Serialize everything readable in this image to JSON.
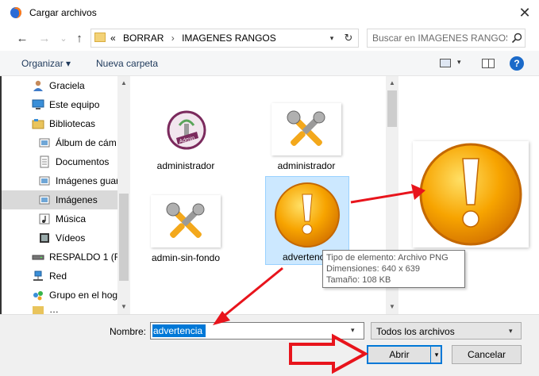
{
  "window": {
    "title": "Cargar archivos",
    "close_glyph": "✕"
  },
  "nav": {
    "back_glyph": "←",
    "forward_glyph": "→",
    "recent_glyph": "⌄",
    "up_glyph": "↑",
    "breadcrumb": {
      "overflow": "«",
      "items": [
        "BORRAR",
        "IMAGENES RANGOS"
      ],
      "separator": "›"
    },
    "dropdown_glyph": "▾",
    "refresh_glyph": "↻",
    "search_placeholder": "Buscar en IMAGENES RANGOS"
  },
  "toolbar": {
    "organize_label": "Organizar ▾",
    "new_folder_label": "Nueva carpeta",
    "view_dropdown_glyph": "▾",
    "help_glyph": "?"
  },
  "sidebar": {
    "items": [
      {
        "label": "Graciela",
        "icon": "user-icon"
      },
      {
        "label": "Este equipo",
        "icon": "computer-icon"
      },
      {
        "label": "Bibliotecas",
        "icon": "libraries-icon"
      },
      {
        "label": "Álbum de cám",
        "icon": "pictures-icon"
      },
      {
        "label": "Documentos",
        "icon": "documents-icon"
      },
      {
        "label": "Imágenes guar",
        "icon": "pictures-icon"
      },
      {
        "label": "Imágenes",
        "icon": "pictures-icon"
      },
      {
        "label": "Música",
        "icon": "music-icon"
      },
      {
        "label": "Vídeos",
        "icon": "videos-icon"
      },
      {
        "label": "RESPALDO 1 (F:)",
        "icon": "drive-icon"
      },
      {
        "label": "Red",
        "icon": "network-icon"
      },
      {
        "label": "Grupo en el hog",
        "icon": "homegroup-icon"
      },
      {
        "label": "…",
        "icon": "folder-icon"
      }
    ]
  },
  "files": [
    {
      "label": "administrador",
      "thumb": "admin-badge-icon"
    },
    {
      "label": "administrador",
      "thumb": "tools-icon"
    },
    {
      "label": "admin-sin-fondo",
      "thumb": "tools-icon"
    },
    {
      "label": "advertencia",
      "thumb": "warning-icon"
    }
  ],
  "tooltip": {
    "type": "Tipo de elemento: Archivo PNG",
    "dimensions": "Dimensiones: 640 x 639",
    "size": "Tamaño: 108 KB"
  },
  "footer": {
    "name_label": "Nombre:",
    "name_value": "advertencia",
    "type_value": "Todos los archivos",
    "open_label": "Abrir",
    "cancel_label": "Cancelar",
    "dropdown_glyph": "▾"
  },
  "colors": {
    "accent": "#0078d7",
    "annotation_red": "#e8141c",
    "warning_orange": "#f7a400"
  }
}
